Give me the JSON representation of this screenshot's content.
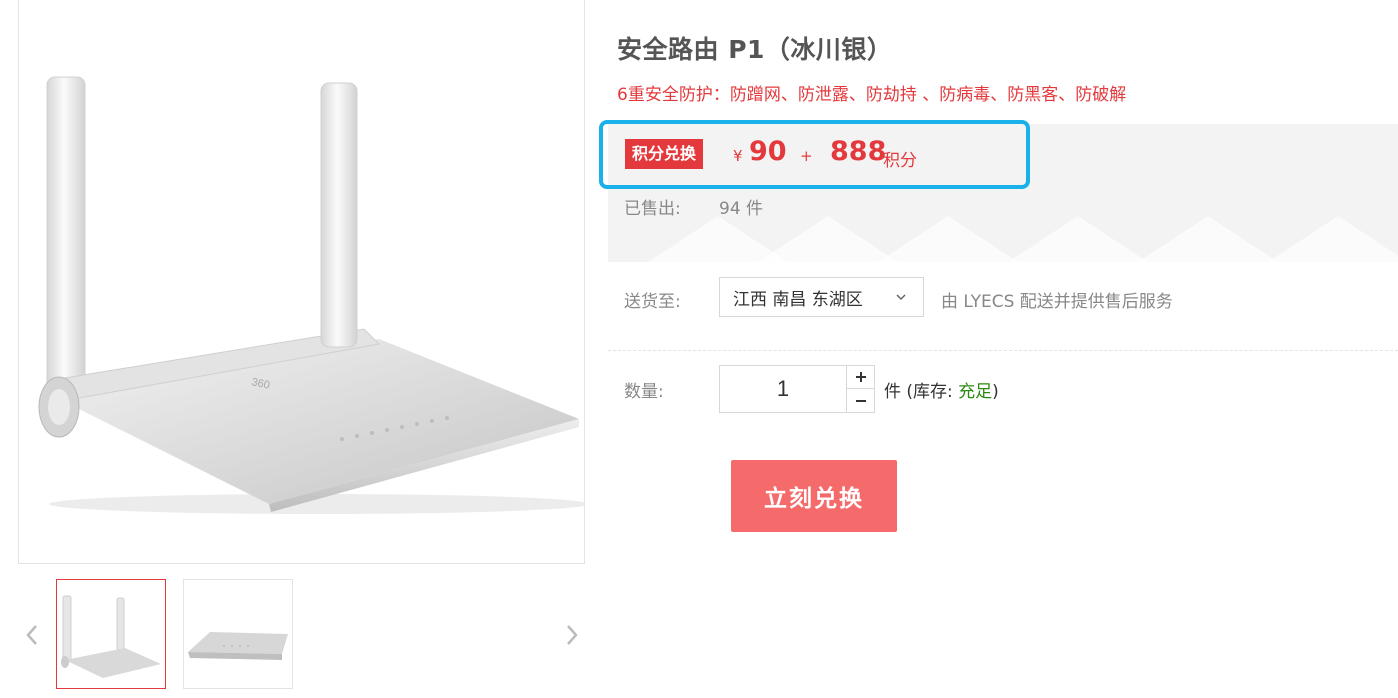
{
  "product": {
    "title": "安全路由 P1（冰川银）",
    "subtitle": "6重安全防护：防蹭网、防泄露、防劫持 、防病毒、防黑客、防破解",
    "image_logo": "360"
  },
  "price": {
    "badge": "积分兑换",
    "currency_symbol": "¥",
    "cash_amount": "90",
    "plus_sign": "+",
    "points_amount": "888",
    "points_unit": "积分"
  },
  "sales": {
    "label": "已售出:",
    "value": "94 件"
  },
  "shipping": {
    "label": "送货至:",
    "region": "江西 南昌 东湖区",
    "note": "由 LYECS 配送并提供售后服务"
  },
  "quantity": {
    "label": "数量:",
    "value": "1",
    "plus": "+",
    "minus": "−",
    "stock_prefix": "件 (库存:",
    "stock_status": "充足",
    "stock_suffix": ")"
  },
  "actions": {
    "redeem_label": "立刻兑换"
  },
  "colors": {
    "accent": "#e4393c",
    "button": "#f56a6a",
    "highlight": "#1ab0ea",
    "stock_ok": "#2b8a10"
  },
  "icons": {
    "prev": "chevron-left-icon",
    "next": "chevron-right-icon",
    "select": "chevron-down-icon"
  }
}
